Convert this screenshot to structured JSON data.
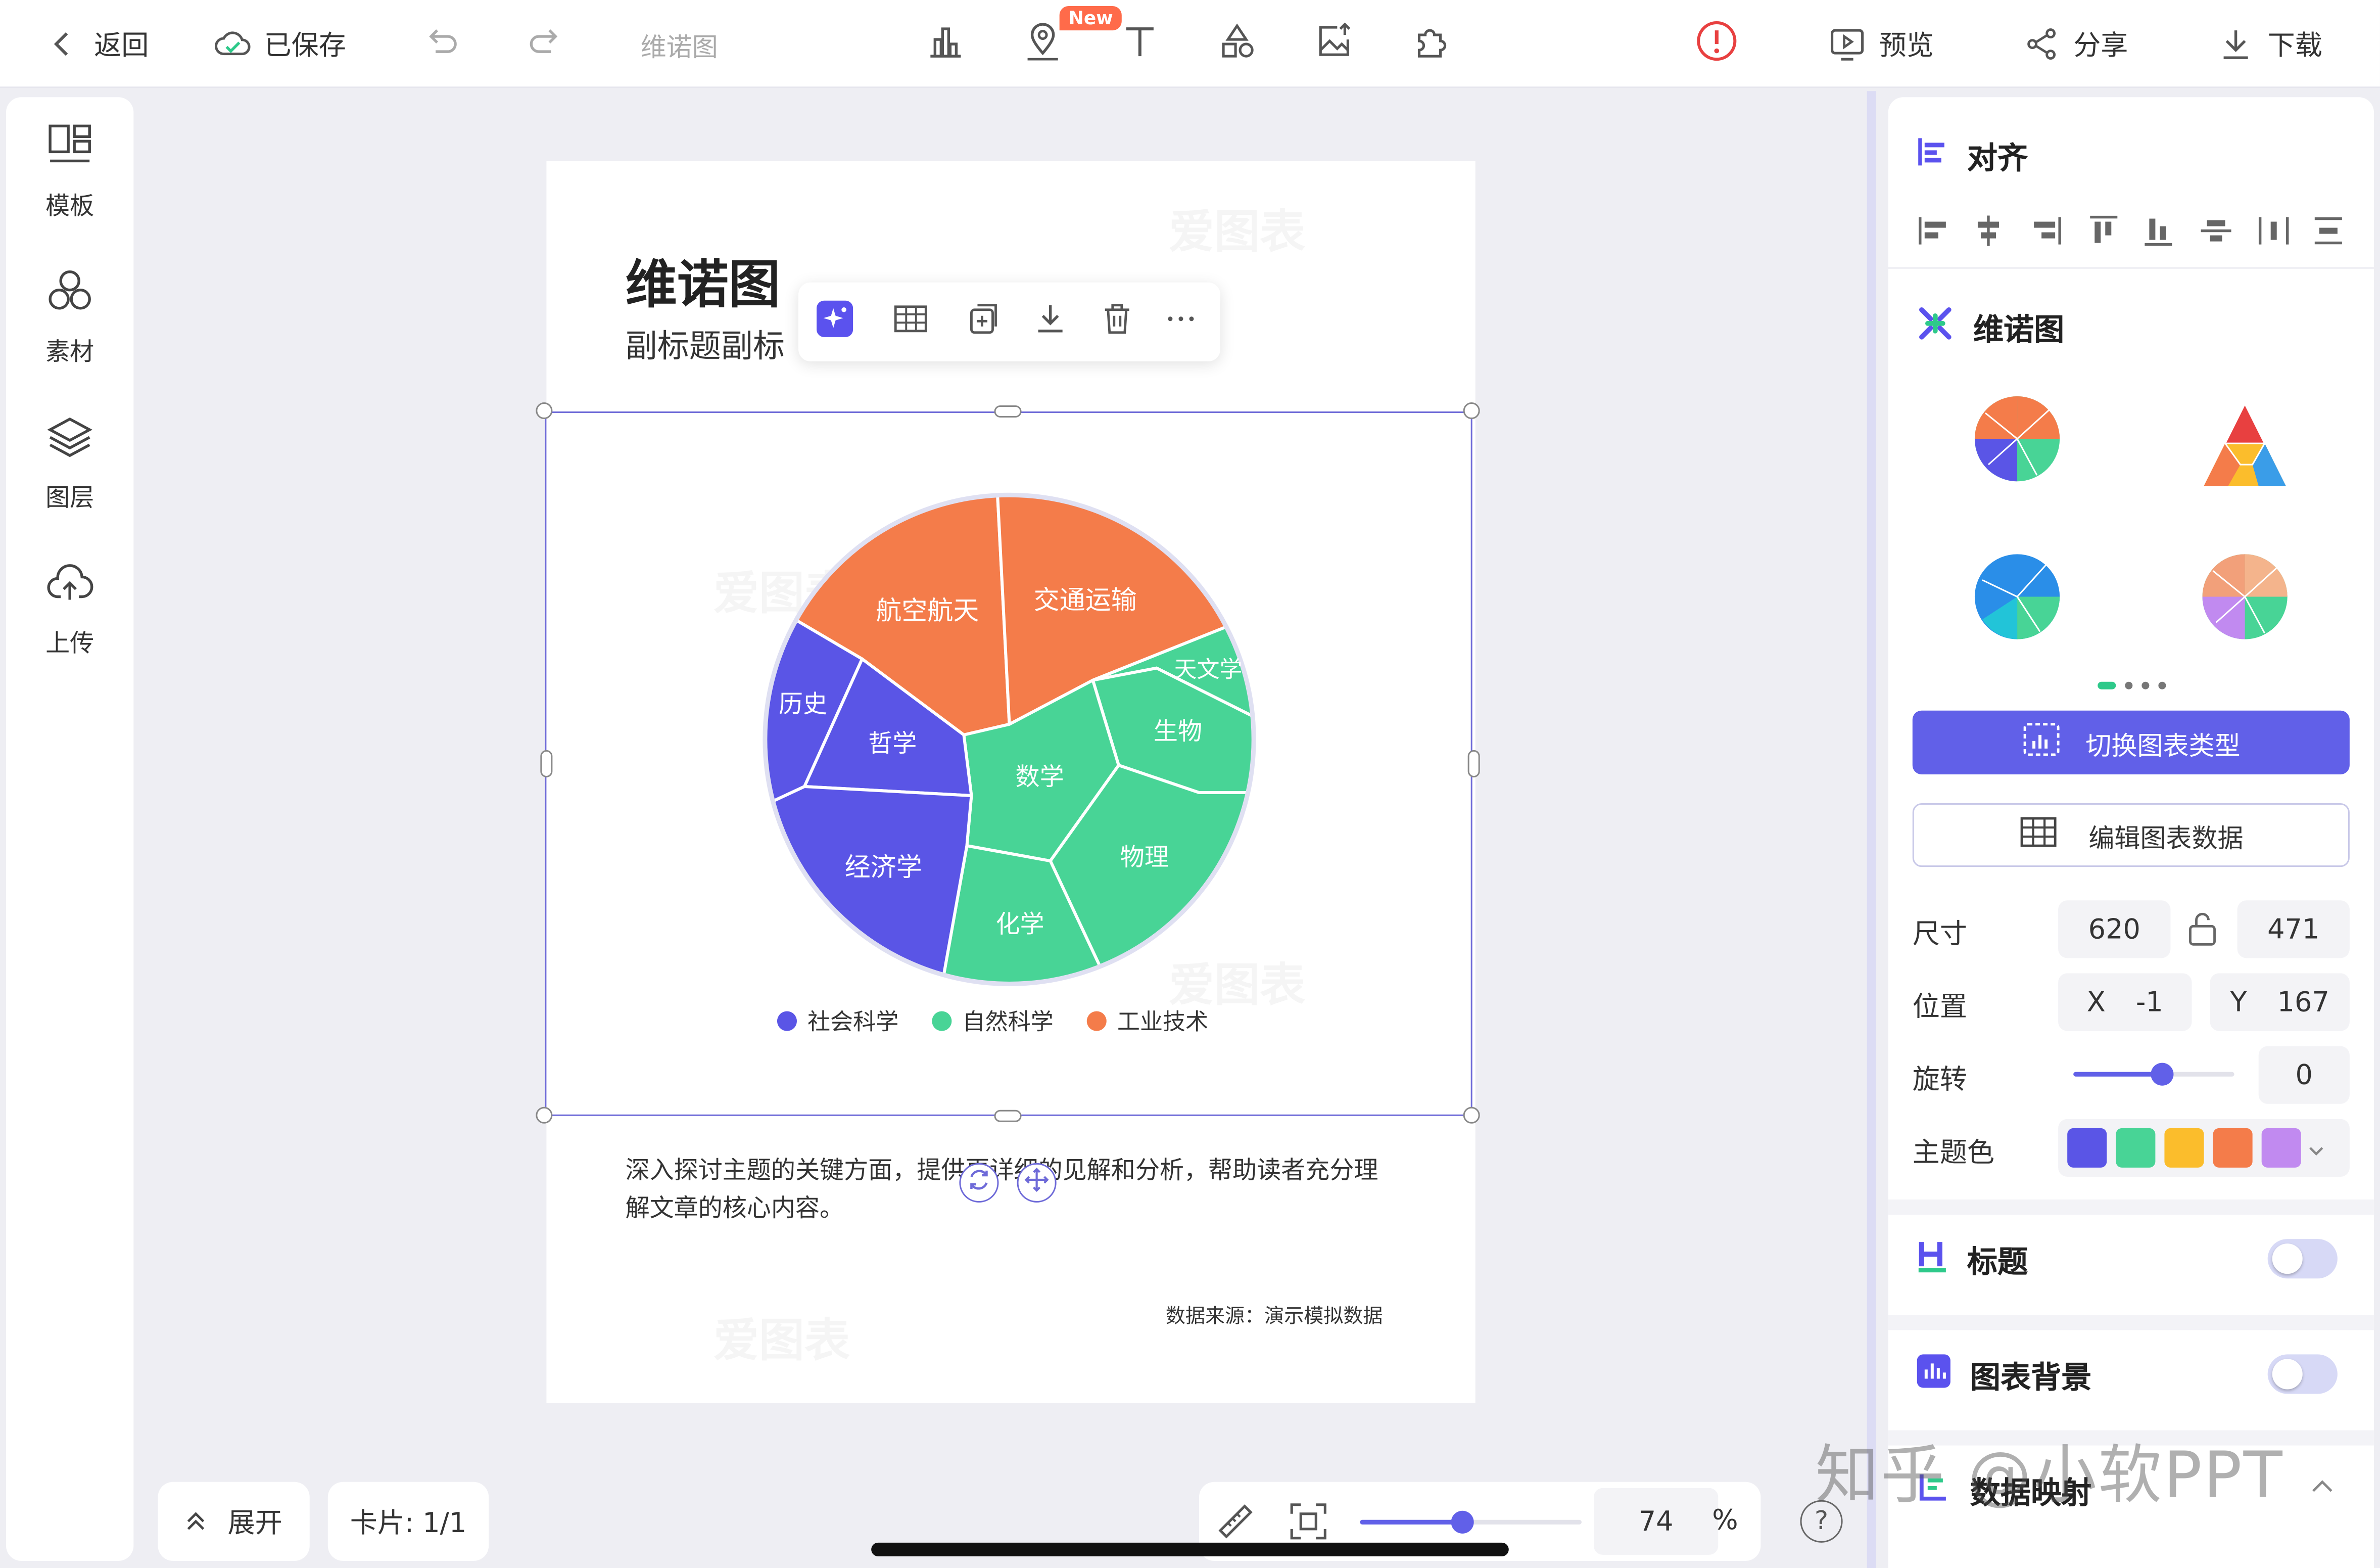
{
  "topbar": {
    "back_label": "返回",
    "saved_label": "已保存",
    "doc_name": "维诺图",
    "new_badge": "New",
    "preview_label": "预览",
    "share_label": "分享",
    "download_label": "下载"
  },
  "sidebar": {
    "items": [
      {
        "label": "模板"
      },
      {
        "label": "素材"
      },
      {
        "label": "图层"
      },
      {
        "label": "上传"
      }
    ]
  },
  "card": {
    "title": "维诺图",
    "subtitle": "副标题副标",
    "body": "深入探讨主题的关键方面，提供更详细的见解和分析，帮助读者充分理解文章的核心内容。",
    "source": "数据来源：演示模拟数据",
    "watermark": "爱图表"
  },
  "chart_data": {
    "type": "voronoi",
    "cells": [
      {
        "label": "航空航天",
        "group": "工业技术"
      },
      {
        "label": "交通运输",
        "group": "工业技术"
      },
      {
        "label": "天文学",
        "group": "自然科学"
      },
      {
        "label": "生物",
        "group": "自然科学"
      },
      {
        "label": "数学",
        "group": "自然科学"
      },
      {
        "label": "物理",
        "group": "自然科学"
      },
      {
        "label": "化学",
        "group": "自然科学"
      },
      {
        "label": "历史",
        "group": "社会科学"
      },
      {
        "label": "哲学",
        "group": "社会科学"
      },
      {
        "label": "经济学",
        "group": "社会科学"
      }
    ],
    "legend": [
      {
        "name": "社会科学",
        "color": "#5a55e6"
      },
      {
        "name": "自然科学",
        "color": "#48d496"
      },
      {
        "name": "工业技术",
        "color": "#f47c4a"
      }
    ]
  },
  "bottombar": {
    "expand_label": "展开",
    "card_label": "卡片: 1/1",
    "zoom_value": "74",
    "zoom_unit": "%",
    "help_label": "?"
  },
  "rightpanel": {
    "align_title": "对齐",
    "chart_title": "维诺图",
    "switch_type_label": "切换图表类型",
    "edit_data_label": "编辑图表数据",
    "size_label": "尺寸",
    "width": "620",
    "height": "471",
    "position_label": "位置",
    "x_label": "X",
    "x_value": "-1",
    "y_label": "Y",
    "y_value": "167",
    "rotate_label": "旋转",
    "rotate_value": "0",
    "rotate_level": 0.55,
    "theme_label": "主题色",
    "theme_colors": [
      "#5a55e6",
      "#48d496",
      "#fbbd2c",
      "#f47c4a",
      "#c18af0"
    ],
    "title_section": "标题",
    "bg_section": "图表背景",
    "mapping_section": "数据映射"
  },
  "watermark_text": "知乎 @小软PPT"
}
